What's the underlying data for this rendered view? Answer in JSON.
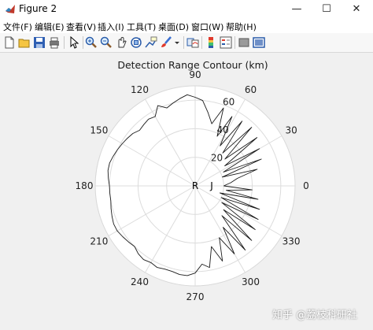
{
  "window": {
    "title": "Figure 2",
    "minimize_glyph": "—",
    "maximize_glyph": "☐",
    "close_glyph": "✕"
  },
  "menu": [
    "文件(F)",
    "编辑(E)",
    "查看(V)",
    "插入(I)",
    "工具(T)",
    "桌面(D)",
    "窗口(W)",
    "帮助(H)"
  ],
  "toolbar_icons": [
    "new-figure-icon",
    "open-file-icon",
    "save-icon",
    "print-icon",
    "select-arrow-icon",
    "zoom-in-icon",
    "zoom-out-icon",
    "pan-icon",
    "rotate-3d-icon",
    "data-cursor-icon",
    "brush-icon",
    "link-plot-icon",
    "colorbar-icon",
    "legend-icon",
    "hide-plot-tools-icon",
    "show-plot-tools-icon"
  ],
  "chart_data": {
    "type": "line",
    "projection": "polar",
    "title": "Detection Range Contour (km)",
    "angle_ticks": [
      "0",
      "30",
      "60",
      "90",
      "120",
      "150",
      "180",
      "210",
      "240",
      "270",
      "300",
      "330"
    ],
    "radial_ticks": [
      "20",
      "40",
      "60"
    ],
    "rlim": [
      0,
      70
    ],
    "center_label": "R",
    "center_label_2": "J",
    "line_color": "#1a1a1a",
    "grid": true,
    "series": [
      {
        "theta_deg": [
          0,
          5,
          10,
          15,
          18,
          22,
          26,
          30,
          34,
          38,
          42,
          46,
          50,
          54,
          58,
          62,
          66,
          70,
          75,
          80,
          85,
          90,
          95,
          100,
          105,
          110,
          115,
          120,
          125,
          130,
          135,
          140,
          145,
          150,
          155,
          160,
          165,
          170,
          175,
          180,
          185,
          190,
          195,
          200,
          205,
          210,
          215,
          220,
          225,
          230,
          235,
          240,
          245,
          250,
          255,
          260,
          265,
          270,
          275,
          280,
          285,
          290,
          295,
          300,
          304,
          308,
          312,
          316,
          320,
          324,
          328,
          332,
          336,
          340,
          344,
          348,
          352,
          356,
          360
        ],
        "r_km": [
          20,
          25,
          30,
          45,
          20,
          50,
          22,
          52,
          25,
          55,
          28,
          57,
          30,
          56,
          33,
          55,
          38,
          58,
          45,
          52,
          60,
          62,
          64,
          62,
          60,
          58,
          62,
          56,
          57,
          56,
          55,
          57,
          58,
          59,
          60,
          61,
          62,
          62,
          61,
          60,
          60,
          60,
          61,
          62,
          63,
          63,
          62,
          61,
          60,
          62,
          63,
          62,
          63,
          62,
          62,
          63,
          63,
          61,
          55,
          58,
          44,
          56,
          40,
          55,
          35,
          57,
          28,
          55,
          26,
          52,
          22,
          50,
          20,
          48,
          18,
          45,
          22,
          40,
          20
        ]
      }
    ]
  }
}
